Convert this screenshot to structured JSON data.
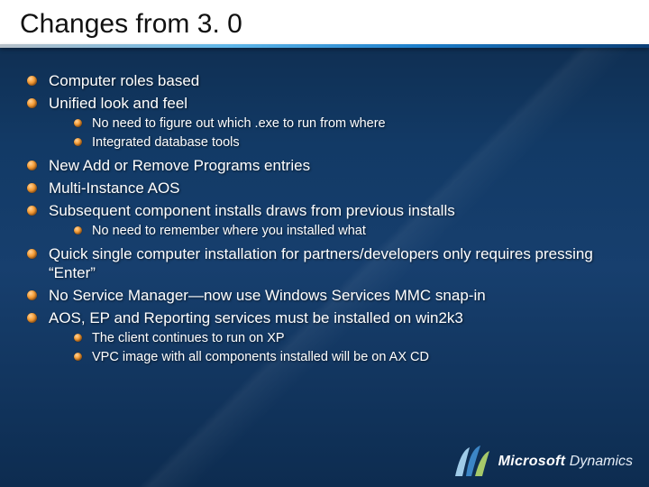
{
  "title": "Changes from 3. 0",
  "bullets": {
    "b1": "Computer roles based",
    "b2": "Unified look and feel",
    "sub2": {
      "a": "No need to figure out which .exe to run from where",
      "b": "Integrated database tools"
    },
    "b3": "New Add or Remove Programs entries",
    "b4": "Multi-Instance AOS",
    "b5": "Subsequent component installs draws from previous installs",
    "sub5": {
      "a": "No need to remember where you installed what"
    },
    "b6": "Quick single computer installation for partners/developers only requires pressing “Enter”",
    "b7": "No Service Manager—now use Windows Services MMC snap-in",
    "b8": "AOS, EP and Reporting services must be installed on win2k3",
    "sub8": {
      "a": "The client continues to run on XP",
      "b": "VPC image with all components installed will be on AX CD"
    }
  },
  "brand": {
    "name1": "Microsoft",
    "name2": "Dynamics"
  }
}
